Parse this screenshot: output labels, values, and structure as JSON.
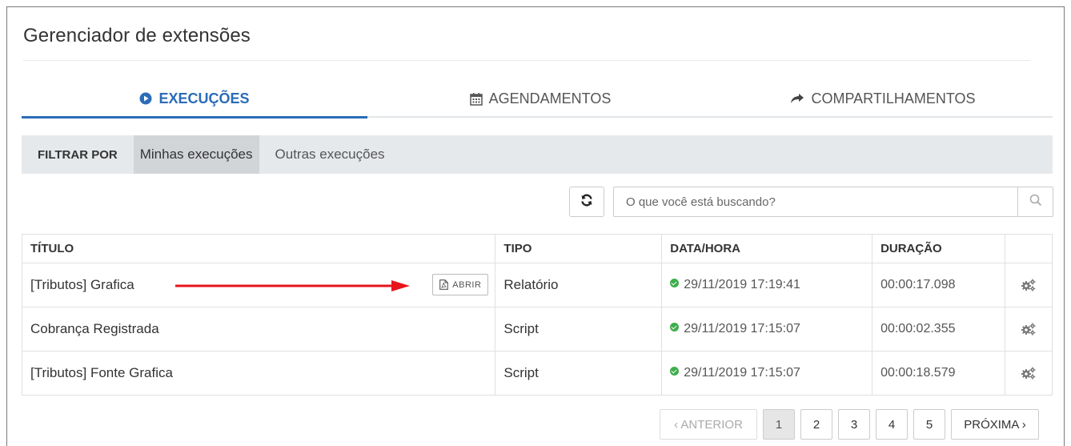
{
  "page": {
    "title": "Gerenciador de extensões"
  },
  "tabs": [
    {
      "label": "EXECUÇÕES",
      "icon": "play-circle-icon",
      "active": true
    },
    {
      "label": "AGENDAMENTOS",
      "icon": "calendar-icon",
      "active": false
    },
    {
      "label": "COMPARTILHAMENTOS",
      "icon": "share-icon",
      "active": false
    }
  ],
  "filter": {
    "label": "FILTRAR POR",
    "options": [
      {
        "label": "Minhas execuções",
        "selected": true
      },
      {
        "label": "Outras execuções",
        "selected": false
      }
    ]
  },
  "search": {
    "placeholder": "O que você está buscando?"
  },
  "table": {
    "headers": [
      "TÍTULO",
      "TIPO",
      "DATA/HORA",
      "DURAÇÃO",
      ""
    ],
    "rows": [
      {
        "title": "[Tributos] Grafica",
        "type": "Relatório",
        "datetime": "29/11/2019 17:19:41",
        "duration": "00:00:17.098",
        "status": "success",
        "open_label": "ABRIR"
      },
      {
        "title": "Cobrança Registrada",
        "type": "Script",
        "datetime": "29/11/2019 17:15:07",
        "duration": "00:00:02.355",
        "status": "success"
      },
      {
        "title": "[Tributos] Fonte Grafica",
        "type": "Script",
        "datetime": "29/11/2019 17:15:07",
        "duration": "00:00:18.579",
        "status": "success"
      }
    ]
  },
  "pagination": {
    "prev_label": "‹ ANTERIOR",
    "pages": [
      "1",
      "2",
      "3",
      "4",
      "5"
    ],
    "current_page": "1",
    "next_label": "PRÓXIMA ›"
  },
  "colors": {
    "accent": "#2b6cb8",
    "success": "#3cae4a",
    "annotation_arrow": "#e8141b"
  }
}
